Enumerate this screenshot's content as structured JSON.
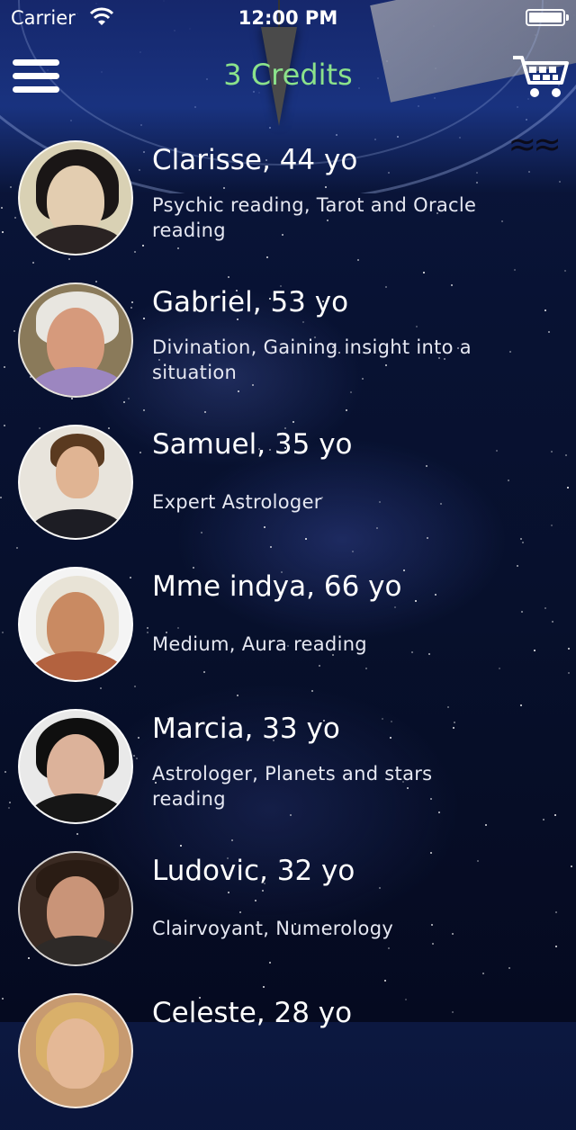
{
  "status_bar": {
    "carrier": "Carrier",
    "time": "12:00 PM"
  },
  "nav": {
    "credits": "3 Credits",
    "credits_color": "#8be28b",
    "menu_icon": "hamburger-menu-icon",
    "cart_icon": "shopping-cart-icon"
  },
  "readers": [
    {
      "name": "Clarisse, 44 yo",
      "skills": "Psychic reading, Tarot and Oracle reading"
    },
    {
      "name": "Gabriel, 53 yo",
      "skills": "Divination, Gaining insight into a situation"
    },
    {
      "name": "Samuel, 35 yo",
      "skills": "Expert Astrologer"
    },
    {
      "name": "Mme indya, 66 yo",
      "skills": "Medium, Aura reading"
    },
    {
      "name": "Marcia, 33 yo",
      "skills": "Astrologer, Planets and stars reading"
    },
    {
      "name": "Ludovic, 32 yo",
      "skills": "Clairvoyant, Numerology"
    },
    {
      "name": "Celeste, 28 yo",
      "skills": ""
    }
  ]
}
